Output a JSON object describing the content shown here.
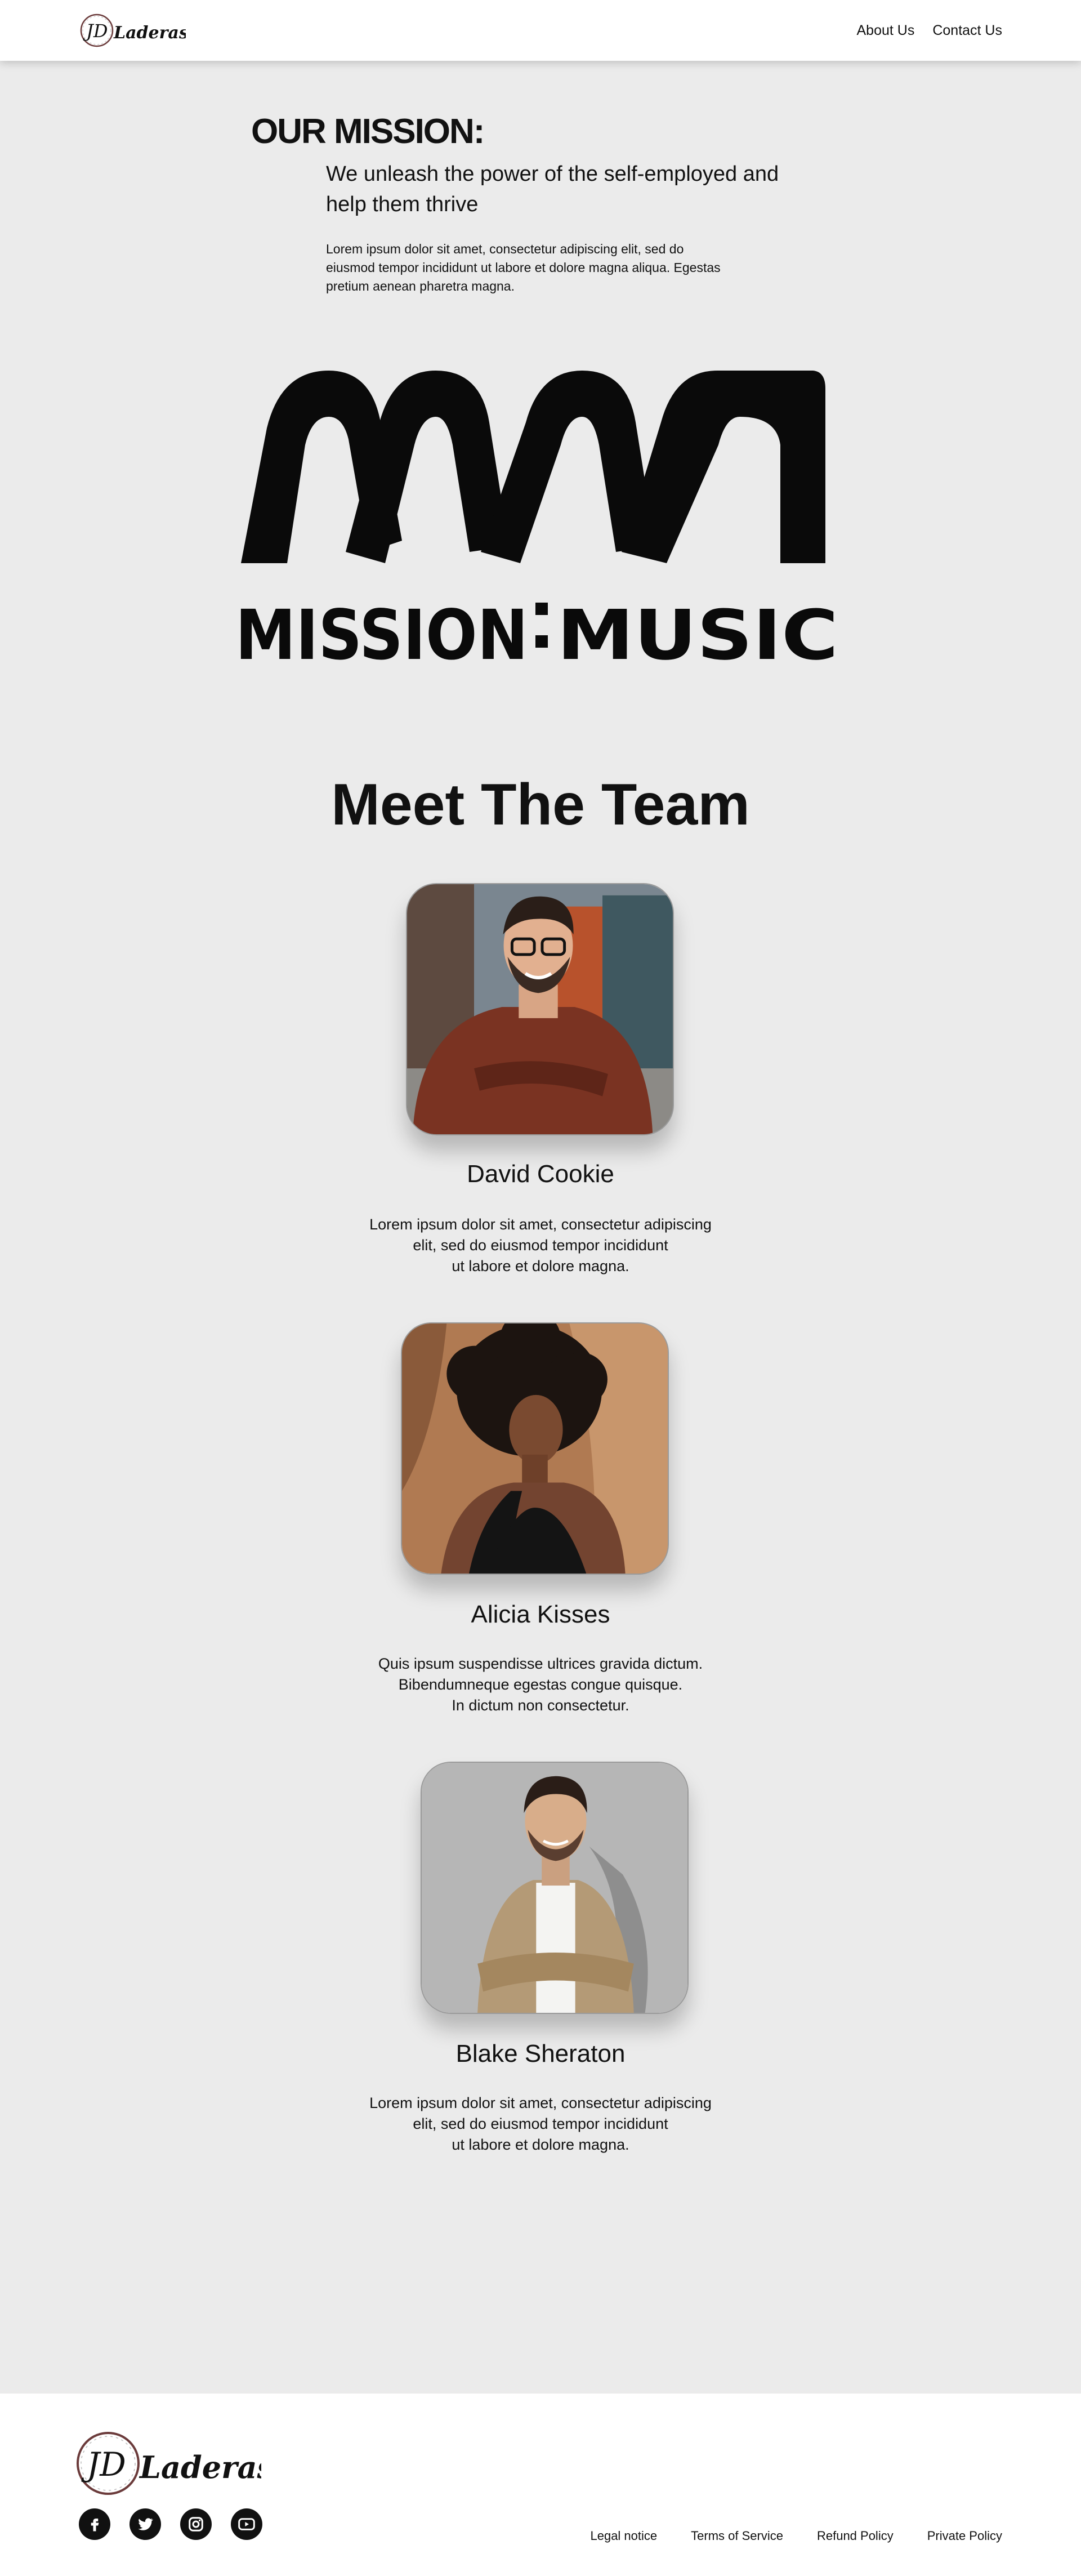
{
  "header": {
    "logo_initials": "JD",
    "logo_text": "Laderas",
    "nav": [
      "About Us",
      "Contact Us"
    ]
  },
  "mission": {
    "heading": "OUR MISSION:",
    "subheading": "We unleash the power of the self-employed and help them thrive",
    "body": "Lorem ipsum dolor sit amet, consectetur adipiscing elit, sed do eiusmod tempor incididunt ut labore et dolore magna aliqua. Egestas pretium aenean pharetra magna.",
    "logo_text_left": "MISSION",
    "logo_text_right": "MUSIC"
  },
  "team": {
    "title": "Meet The Team",
    "members": [
      {
        "name": "David Cookie",
        "bio": "Lorem ipsum dolor sit amet, consectetur adipiscing\nelit, sed do eiusmod tempor incididunt\nut labore et dolore magna."
      },
      {
        "name": "Alicia Kisses",
        "bio": "Quis ipsum suspendisse ultrices gravida dictum.\nBibendumneque egestas congue quisque.\nIn dictum non consectetur."
      },
      {
        "name": "Blake Sheraton",
        "bio": "Lorem ipsum dolor sit amet, consectetur adipiscing\nelit, sed do eiusmod tempor incididunt\nut labore et dolore magna."
      }
    ]
  },
  "footer": {
    "logo_initials": "JD",
    "logo_text": "Laderas",
    "social_icons": [
      "facebook-icon",
      "twitter-icon",
      "instagram-icon",
      "youtube-icon"
    ],
    "links": [
      "Legal notice",
      "Terms of Service",
      "Refund Policy",
      "Private Policy"
    ]
  },
  "colors": {
    "page_background": "#ebebeb",
    "header_background": "#ffffff",
    "text": "#111111"
  }
}
